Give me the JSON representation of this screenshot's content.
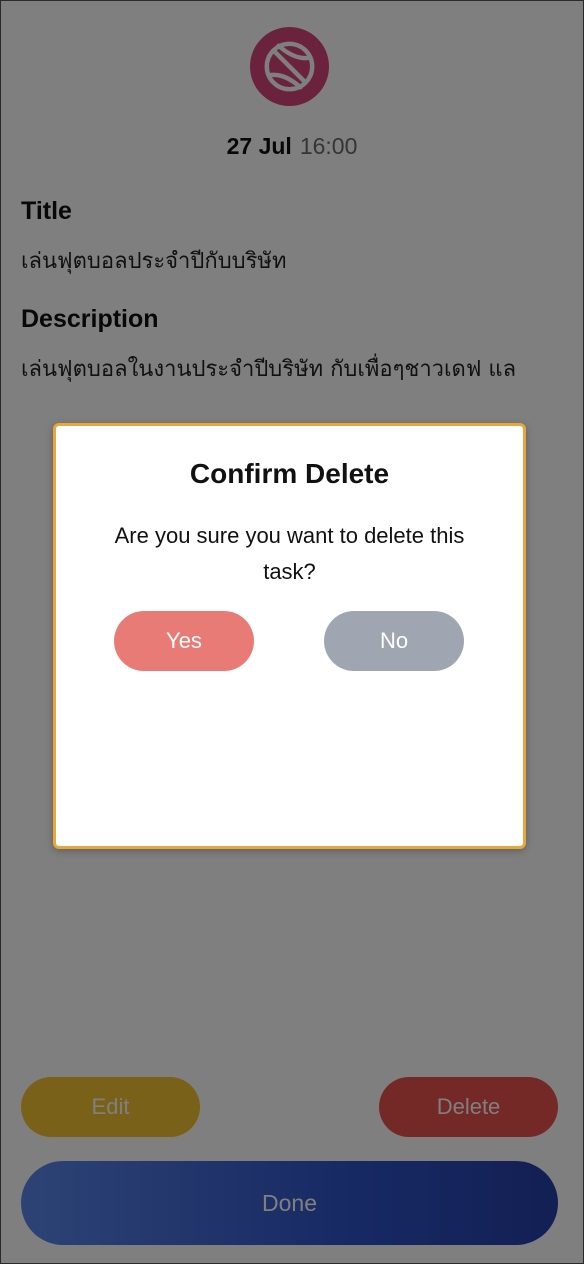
{
  "header": {
    "icon": "basketball-icon",
    "icon_color": "#d6457a",
    "date": "27 Jul",
    "time": "16:00"
  },
  "task": {
    "title_label": "Title",
    "title_value": "เล่นฟุตบอลประจำปีกับบริษัท",
    "description_label": "Description",
    "description_value": "เล่นฟุตบอลในงานประจำปีบริษัท กับเพื่อๆชาวเดฟ แล"
  },
  "actions": {
    "edit_label": "Edit",
    "delete_label": "Delete",
    "done_label": "Done"
  },
  "dialog": {
    "title": "Confirm Delete",
    "message": "Are you sure you want to delete this task?",
    "yes_label": "Yes",
    "no_label": "No",
    "border_color": "#e8a73a"
  }
}
